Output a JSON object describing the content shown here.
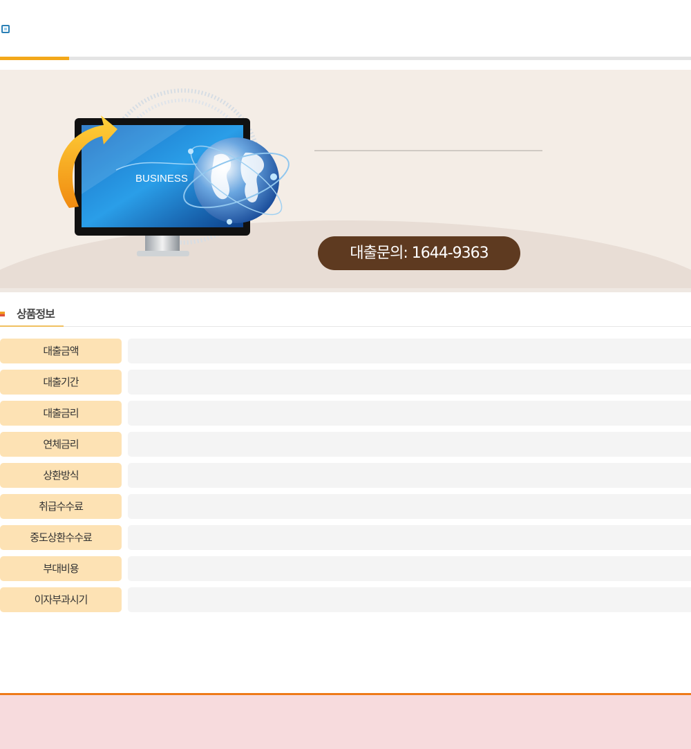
{
  "banner": {
    "illustration_text": "BUSINESS",
    "phone_label": "대출문의: 1644-9363"
  },
  "section": {
    "title": "상품정보"
  },
  "rows": [
    {
      "label": "대출금액",
      "value": ""
    },
    {
      "label": "대출기간",
      "value": ""
    },
    {
      "label": "대출금리",
      "value": ""
    },
    {
      "label": "연체금리",
      "value": ""
    },
    {
      "label": "상환방식",
      "value": ""
    },
    {
      "label": "취급수수료",
      "value": ""
    },
    {
      "label": "중도상환수수료",
      "value": ""
    },
    {
      "label": "부대비용",
      "value": ""
    },
    {
      "label": "이자부과시기",
      "value": ""
    }
  ],
  "colors": {
    "accent_orange": "#f3a81a",
    "pill_brown": "#5e3a20",
    "label_bg": "#fde2b4",
    "footer_bg": "#f7dbdd",
    "footer_rule": "#ee7a18"
  }
}
